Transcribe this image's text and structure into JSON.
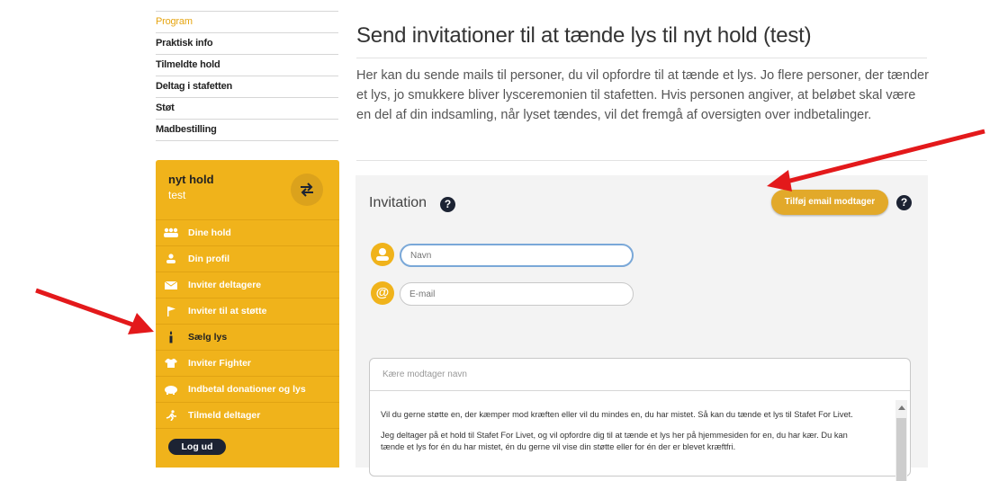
{
  "top_nav": [
    {
      "label": "Program",
      "active": true
    },
    {
      "label": "Praktisk info"
    },
    {
      "label": "Tilmeldte hold"
    },
    {
      "label": "Deltag i stafetten"
    },
    {
      "label": "Støt"
    },
    {
      "label": "Madbestilling"
    }
  ],
  "team_panel": {
    "team_name": "nyt hold",
    "team_sub": "test",
    "swap_icon": "swap-arrows-icon",
    "menu": [
      {
        "label": "Dine hold",
        "icon": "people-icon"
      },
      {
        "label": "Din profil",
        "icon": "person-icon"
      },
      {
        "label": "Inviter deltagere",
        "icon": "envelope-icon"
      },
      {
        "label": "Inviter til at støtte",
        "icon": "flag-icon"
      },
      {
        "label": "Sælg lys",
        "icon": "candle-icon"
      },
      {
        "label": "Inviter Fighter",
        "icon": "tshirt-icon"
      },
      {
        "label": "Indbetal donationer og lys",
        "icon": "piggybank-icon"
      },
      {
        "label": "Tilmeld deltager",
        "icon": "runner-icon"
      }
    ],
    "logout_label": "Log ud"
  },
  "main": {
    "title": "Send invitationer til at tænde lys til nyt hold (test)",
    "intro": "Her kan du sende mails til personer, du vil opfordre til at tænde et lys. Jo flere personer, der tænder et lys, jo smukkere bliver lysceremonien til stafetten. Hvis personen angiver, at beløbet skal være en del af din indsamling, når lyset tændes, vil det fremgå af oversigten over indbetalinger."
  },
  "invitation": {
    "title": "Invitation",
    "help": "?",
    "add_button_label": "Tilføj email modtager",
    "name_placeholder": "Navn",
    "email_placeholder": "E-mail",
    "email_icon": "@",
    "message_placeholder": "Kære modtager navn",
    "message_paragraphs": [
      "Vil du gerne støtte en, der kæmper mod kræften eller vil du mindes en, du har mistet. Så kan du tænde et lys til Stafet For Livet.",
      "Jeg deltager på et hold til Stafet For Livet, og vil opfordre dig til at tænde et lys her på hjemmesiden for en, du har kær. Du kan tænde et lys for én du har mistet, én du gerne vil vise din støtte eller for én der er blevet kræftfri."
    ]
  },
  "colors": {
    "brand_yellow": "#f0b31b",
    "annotation_red": "#e3191b",
    "navy": "#1c2333"
  }
}
